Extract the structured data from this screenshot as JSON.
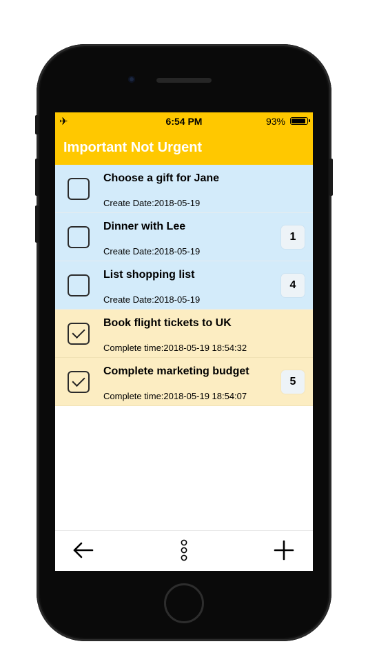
{
  "status_bar": {
    "time": "6:54 PM",
    "battery_percent": "93%",
    "battery_level": 0.93,
    "airplane_icon": "airplane-icon"
  },
  "header": {
    "title": "Important Not Urgent",
    "background_color": "#ffc800",
    "title_color": "#ffffff"
  },
  "tasks": [
    {
      "title": "Choose a gift for Jane",
      "date": "Create Date:2018-05-19",
      "checked": false,
      "badge": ""
    },
    {
      "title": "Dinner with Lee",
      "date": "Create Date:2018-05-19",
      "checked": false,
      "badge": "1"
    },
    {
      "title": "List shopping list",
      "date": "Create Date:2018-05-19",
      "checked": false,
      "badge": "4"
    },
    {
      "title": "Book flight tickets to UK",
      "date": "Complete time:2018-05-19 18:54:32",
      "checked": true,
      "badge": ""
    },
    {
      "title": "Complete marketing budget",
      "date": "Complete time:2018-05-19 18:54:07",
      "checked": true,
      "badge": "5"
    }
  ],
  "colors": {
    "pending_row": "#d3ebfa",
    "completed_row": "#fcedc2"
  },
  "toolbar": {
    "back_icon": "arrow-left-icon",
    "more_icon": "more-vertical-icon",
    "add_icon": "plus-icon"
  }
}
